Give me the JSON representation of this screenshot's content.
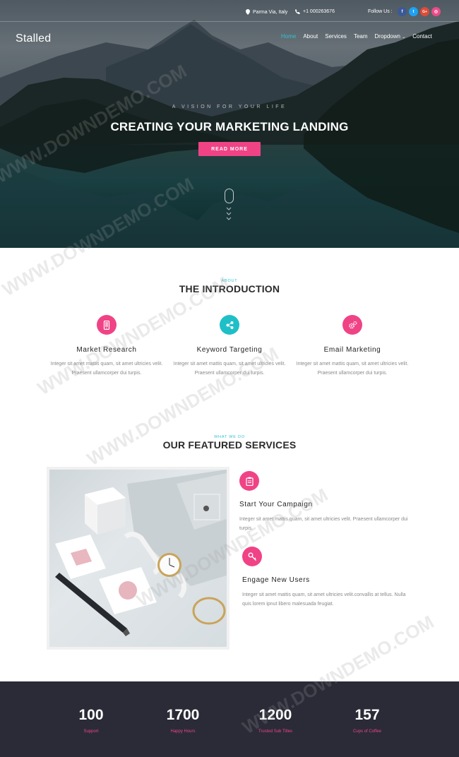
{
  "topbar": {
    "location": "Parma Via, Italy",
    "phone": "+1 000263676",
    "follow_label": "Follow Us :",
    "social": [
      {
        "icon": "facebook-icon",
        "glyph": "f",
        "color": "#3b5998"
      },
      {
        "icon": "twitter-icon",
        "glyph": "t",
        "color": "#1da1f2"
      },
      {
        "icon": "google-plus-icon",
        "glyph": "G+",
        "color": "#dd4b39"
      },
      {
        "icon": "dribbble-icon",
        "glyph": "◎",
        "color": "#ea4c89"
      }
    ]
  },
  "brand": "Stalled",
  "nav": {
    "items": [
      {
        "label": "Home",
        "active": true
      },
      {
        "label": "About"
      },
      {
        "label": "Services"
      },
      {
        "label": "Team"
      },
      {
        "label": "Dropdown",
        "dropdown": true
      },
      {
        "label": "Contact"
      }
    ]
  },
  "hero": {
    "tagline": "A VISION FOR YOUR LIFE",
    "headline": "CREATING YOUR MARKETING LANDING",
    "button": "READ MORE"
  },
  "intro": {
    "kicker": "ABOUT",
    "title": "THE INTRODUCTION",
    "features": [
      {
        "title": "Market Research",
        "icon": "mobile-icon",
        "color": "#f04386",
        "text": "Integer sit amet mattis quam, sit amet ultricies velit. Praesent ullamcorper dui turpis."
      },
      {
        "title": "Keyword Targeting",
        "icon": "share-icon",
        "color": "#1fbfc8",
        "text": "Integer sit amet mattis quam, sit amet ultricies velit. Praesent ullamcorper dui turpis."
      },
      {
        "title": "Email Marketing",
        "icon": "gears-icon",
        "color": "#f04386",
        "text": "Integer sit amet mattis quam, sit amet ultricies velit. Praesent ullamcorper dui turpis."
      }
    ]
  },
  "services": {
    "kicker": "WHAT WE DO",
    "title": "OUR FEATURED SERVICES",
    "items": [
      {
        "title": "Start Your Campaign",
        "icon": "clipboard-icon",
        "color": "#f04386",
        "text": "Integer sit amet mattis quam, sit amet ultricies velit. Praesent ullamcorper dui turpis."
      },
      {
        "title": "Engage New Users",
        "icon": "key-icon",
        "color": "#f04386",
        "text": "Integer sit amet mattis quam, sit amet ultricies velit.convallis at tellus. Nulla quis lorem ipnut libero malesuada feugiat."
      }
    ]
  },
  "stats": [
    {
      "value": "100",
      "label": "Support"
    },
    {
      "value": "1700",
      "label": "Happy Hours"
    },
    {
      "value": "1200",
      "label": "Trusted Sub Titles"
    },
    {
      "value": "157",
      "label": "Cups of Coffee"
    }
  ],
  "watermark": "WWW.DOWNDEMO.COM",
  "colors": {
    "accent_pink": "#f04386",
    "accent_teal": "#31c1d0",
    "footer_bg": "#2a2b36"
  }
}
